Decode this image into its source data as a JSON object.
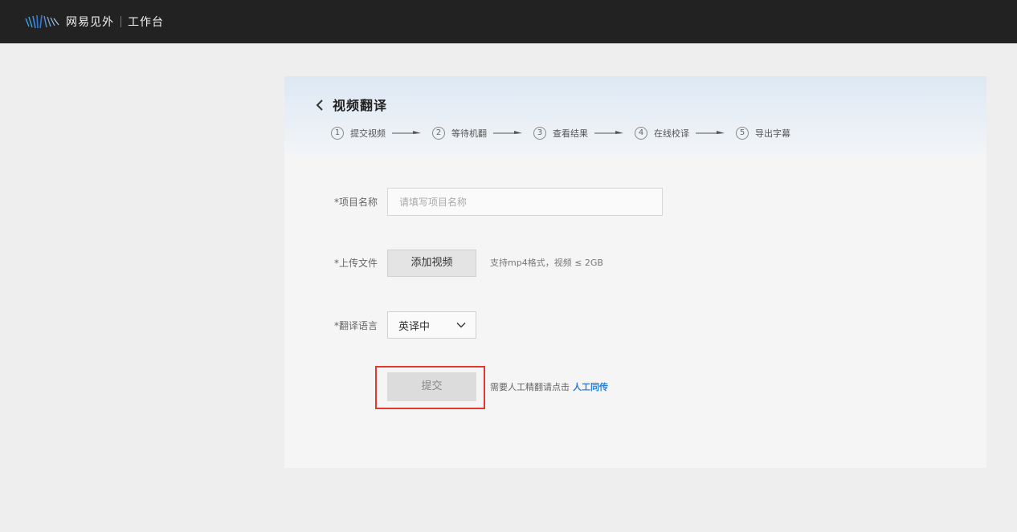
{
  "header": {
    "logo_icon": "wave-lines-logo-icon",
    "brand": "网易见外",
    "workspace": "工作台"
  },
  "card": {
    "title": "视频翻译",
    "back_icon": "chevron-left-icon",
    "steps": [
      {
        "num": "1",
        "label": "提交视频"
      },
      {
        "num": "2",
        "label": "等待机翻"
      },
      {
        "num": "3",
        "label": "查看结果"
      },
      {
        "num": "4",
        "label": "在线校译"
      },
      {
        "num": "5",
        "label": "导出字幕"
      }
    ]
  },
  "form": {
    "name_label": "*项目名称",
    "name_value": "",
    "name_placeholder": "请填写项目名称",
    "upload_label": "*上传文件",
    "upload_button": "添加视频",
    "upload_hint": "支持mp4格式，视频 ≤ 2GB",
    "language_label": "*翻译语言",
    "language_value": "英译中",
    "submit_button": "提交",
    "submit_hint": "需要人工精翻请点击",
    "submit_link": "人工同传"
  },
  "colors": {
    "topbar": "#222222",
    "highlight_border": "#e03a2e",
    "link": "#2f7fd8"
  }
}
